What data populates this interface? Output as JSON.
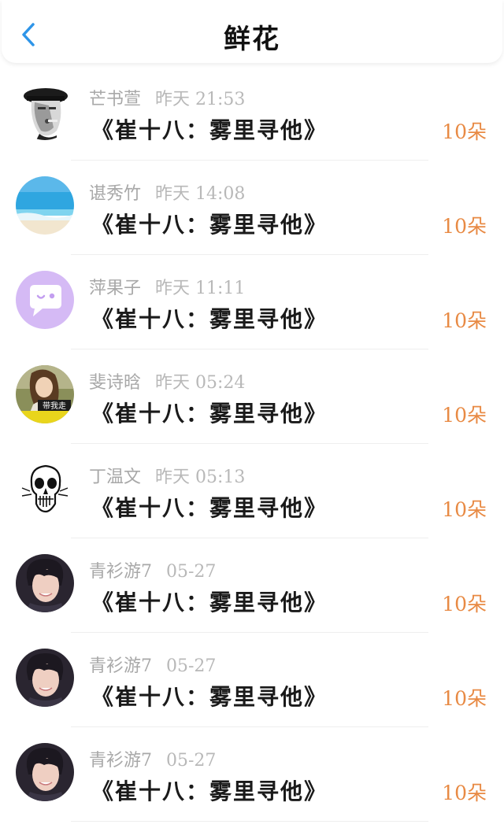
{
  "header": {
    "title": "鲜花",
    "back_icon": "chevron-left-icon",
    "accent_color": "#2e95e8"
  },
  "records": [
    {
      "name": "芒书萱",
      "time": "昨天 21:53",
      "book": "《崔十八：雾里寻他》",
      "amount": "10朵",
      "avatar": "man-in-cap-bw"
    },
    {
      "name": "谌秀竹",
      "time": "昨天 14:08",
      "book": "《崔十八：雾里寻他》",
      "amount": "10朵",
      "avatar": "beach-sea"
    },
    {
      "name": "萍果子",
      "time": "昨天 11:11",
      "book": "《崔十八：雾里寻他》",
      "amount": "10朵",
      "avatar": "purple-chat-bubble"
    },
    {
      "name": "斐诗晗",
      "time": "昨天 05:24",
      "book": "《崔十八：雾里寻他》",
      "amount": "10朵",
      "avatar": "girl-带我走",
      "avatar_caption": "带我走"
    },
    {
      "name": "丁温文",
      "time": "昨天 05:13",
      "book": "《崔十八：雾里寻他》",
      "amount": "10朵",
      "avatar": "skull-sketch"
    },
    {
      "name": "青衫游7",
      "time": "05-27",
      "book": "《崔十八：雾里寻他》",
      "amount": "10朵",
      "avatar": "young-man-portrait"
    },
    {
      "name": "青衫游7",
      "time": "05-27",
      "book": "《崔十八：雾里寻他》",
      "amount": "10朵",
      "avatar": "young-man-portrait"
    },
    {
      "name": "青衫游7",
      "time": "05-27",
      "book": "《崔十八：雾里寻他》",
      "amount": "10朵",
      "avatar": "young-man-portrait"
    }
  ],
  "colors": {
    "amount": "#e88a44",
    "name": "#a8a8a8",
    "book": "#1a1a1a"
  }
}
